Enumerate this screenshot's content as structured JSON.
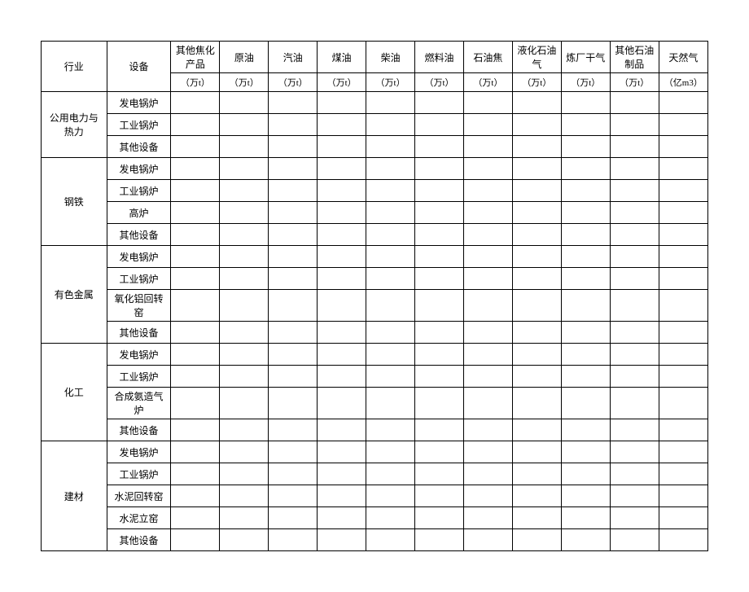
{
  "headers": {
    "industry": "行业",
    "equipment": "设备",
    "cols": [
      "其他焦化产品",
      "原油",
      "汽油",
      "煤油",
      "柴油",
      "燃料油",
      "石油焦",
      "液化石油气",
      "炼厂干气",
      "其他石油制品",
      "天然气"
    ],
    "units": [
      "（万t）",
      "（万t）",
      "（万t）",
      "（万t）",
      "（万t）",
      "（万t）",
      "（万t）",
      "（万t）",
      "（万t）",
      "（万t）",
      "（亿m3）"
    ]
  },
  "industries": [
    {
      "name": "公用电力与热力",
      "equipment": [
        "发电锅炉",
        "工业锅炉",
        "其他设备"
      ]
    },
    {
      "name": "钢铁",
      "equipment": [
        "发电锅炉",
        "工业锅炉",
        "高炉",
        "其他设备"
      ]
    },
    {
      "name": "有色金属",
      "equipment": [
        "发电锅炉",
        "工业锅炉",
        "氧化铝回转窑",
        "其他设备"
      ]
    },
    {
      "name": "化工",
      "equipment": [
        "发电锅炉",
        "工业锅炉",
        "合成氨造气炉",
        "其他设备"
      ]
    },
    {
      "name": "建材",
      "equipment": [
        "发电锅炉",
        "工业锅炉",
        "水泥回转窑",
        "水泥立窑",
        "其他设备"
      ]
    }
  ]
}
